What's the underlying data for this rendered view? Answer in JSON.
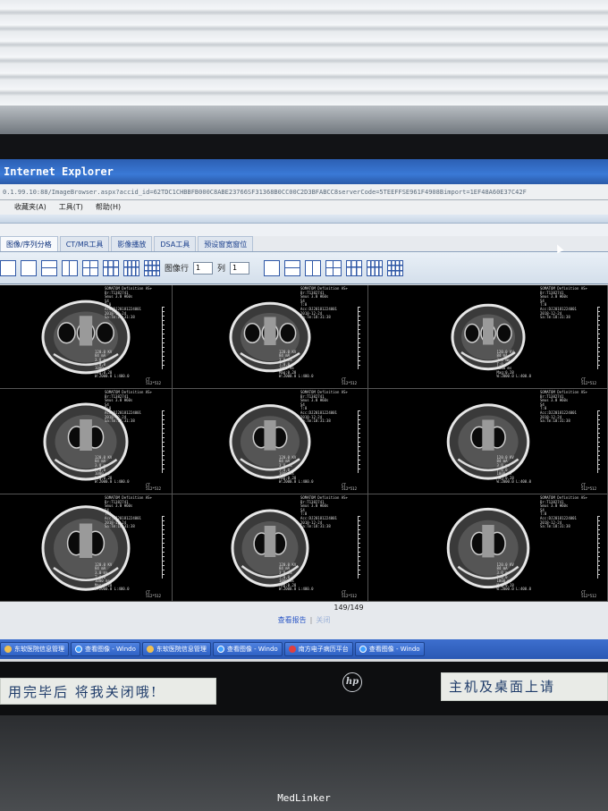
{
  "window": {
    "title": "Internet Explorer",
    "address": "0.1.99.10:88/ImageBrowser.aspx?accid_id=62TDC1CHBBFB000C8ABE23766SF31368B0CC00C2D3BFABCC8serverCode=5TEEFFSE961F4908Bimport=1EF48A60E37C42F"
  },
  "menu": {
    "items": [
      "收藏夹(A)",
      "工具(T)",
      "帮助(H)"
    ]
  },
  "tabs": [
    {
      "label": "图像/序列分格"
    },
    {
      "label": "CT/MR工具"
    },
    {
      "label": "影像播放"
    },
    {
      "label": "DSA工具"
    },
    {
      "label": "预设窗宽窗位"
    }
  ],
  "toolbar": {
    "row_label": "图像行",
    "row_value": "1",
    "col_label": "列",
    "col_value": "1"
  },
  "scan_overlay": {
    "institution": "SOMATOM Definition AS+",
    "top_lines": "SOMATOM Definition AS+\nBr:T1382741\nSmus 3.0 H60s\nS4\nT:0\nAcc:DJ20181224001\n2018-12-24\nSa:Tm:18:31:38",
    "bottom_lines": "120.0 KV\n84 mA\n3.0 mm\nT:0.0\n1000 ms\nMag:0.28\nW:2000.0 L:400.0",
    "modality": "CT",
    "matrix": "512*512"
  },
  "footer": {
    "page": "149/149",
    "report_link": "查看报告",
    "close_link": "关闭"
  },
  "taskbar": {
    "items": [
      {
        "label": "东软医院信息管理"
      },
      {
        "label": "查看图像 - Windo"
      },
      {
        "label": "东软医院信息管理"
      },
      {
        "label": "查看图像 - Windo"
      },
      {
        "label": "南方电子病历平台"
      },
      {
        "label": "查看图像 - Windo"
      }
    ]
  },
  "physical": {
    "brand": "hp",
    "note_left": "用完毕后 将我关闭哦!",
    "note_right": "主机及桌面上请",
    "watermark": "MedLinker"
  }
}
